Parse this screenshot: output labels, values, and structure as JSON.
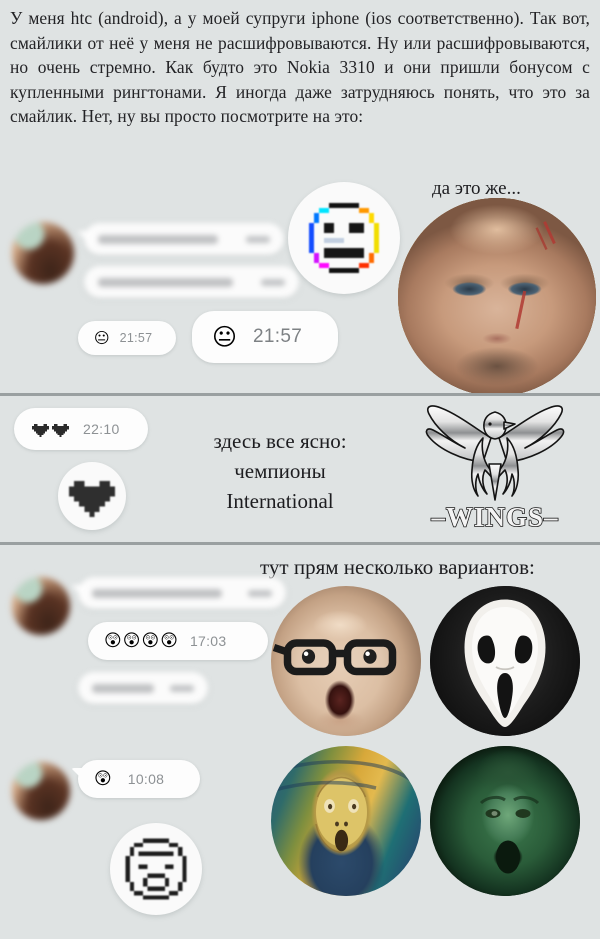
{
  "meta": {
    "background_color": "#dfe3e3",
    "divider_color": "#9aa0a1",
    "bubble_color": "#fdfdfd",
    "time_color": "#8d9194",
    "text_color": "#232326"
  },
  "intro": {
    "text": "У меня htc (android), а у моей супруги iphone (ios соответственно). Так вот, смайлики от неё у меня не расшифровываются. Ну или расшифровываются, но очень стремно. Как будто это Nokia 3310 и  они пришли бонусом с купленными рингтонами. Я иногда даже затрудняюсь понять, что это за смайлик. Нет, ну вы просто посмотрите на это:"
  },
  "panel1": {
    "caption": "да это же...",
    "messages": [
      {
        "id": "msg-blurred-1",
        "text_hidden": true,
        "time_hidden": true
      },
      {
        "id": "msg-blurred-2",
        "text_hidden": true,
        "time_hidden": true
      }
    ],
    "emoji_bubble_small": {
      "emoji": "neutral-face",
      "glyph": "😐",
      "time": "21:57"
    },
    "emoji_bubble_large": {
      "emoji": "neutral-face",
      "glyph": "😐",
      "time": "21:57"
    },
    "sticker": {
      "emoji": "pixelated-neutral-face",
      "glyph": "😐"
    },
    "photo": {
      "name": "scarred-man-photo",
      "alt": "Мужчина со шрамом на лице"
    },
    "avatar": {
      "name": "contact-avatar",
      "alt": "Аватар собеседницы"
    }
  },
  "panel2": {
    "caption_lines": [
      "здесь все ясно:",
      "чемпионы",
      "International"
    ],
    "heart_bubble": {
      "emoji": "black-hearts",
      "glyph": "🖤🖤",
      "count": 2,
      "time": "22:10"
    },
    "sticker": {
      "emoji": "pixelated-black-heart",
      "glyph": "🖤"
    },
    "logo": {
      "name": "wings-logo",
      "text": "–WINGS–",
      "symbol": "eagle"
    }
  },
  "panel3": {
    "caption": "тут прям несколько вариантов:",
    "messages": [
      {
        "id": "msg-blurred-3",
        "text_hidden": true,
        "time_hidden": true
      },
      {
        "id": "msg-blurred-4",
        "text_hidden": true,
        "time_hidden": true
      }
    ],
    "emoji_bubble": {
      "emoji": "face-screaming-in-fear",
      "glyph": "😲😲😲😲",
      "count": 4,
      "time": "17:03"
    },
    "avatar": {
      "name": "contact-avatar",
      "alt": "Аватар собеседницы"
    },
    "photos": [
      {
        "name": "surprised-man-glasses-photo",
        "alt": "Удивлённый мужчина в очках"
      },
      {
        "name": "scream-mask-photo",
        "alt": "Маска Крика"
      },
      {
        "name": "the-scream-painting-photo",
        "alt": "Картина «Крик» Мунка"
      },
      {
        "name": "green-screaming-man-photo",
        "alt": "Кричащий человек в зелёном свете"
      }
    ]
  },
  "panel4": {
    "emoji_bubble": {
      "emoji": "face-screaming-in-fear",
      "glyph": "😲",
      "time": "10:08"
    },
    "sticker": {
      "emoji": "pixelated-screaming-face",
      "glyph": "😲"
    },
    "avatar": {
      "name": "contact-avatar",
      "alt": "Аватар собеседницы"
    }
  }
}
